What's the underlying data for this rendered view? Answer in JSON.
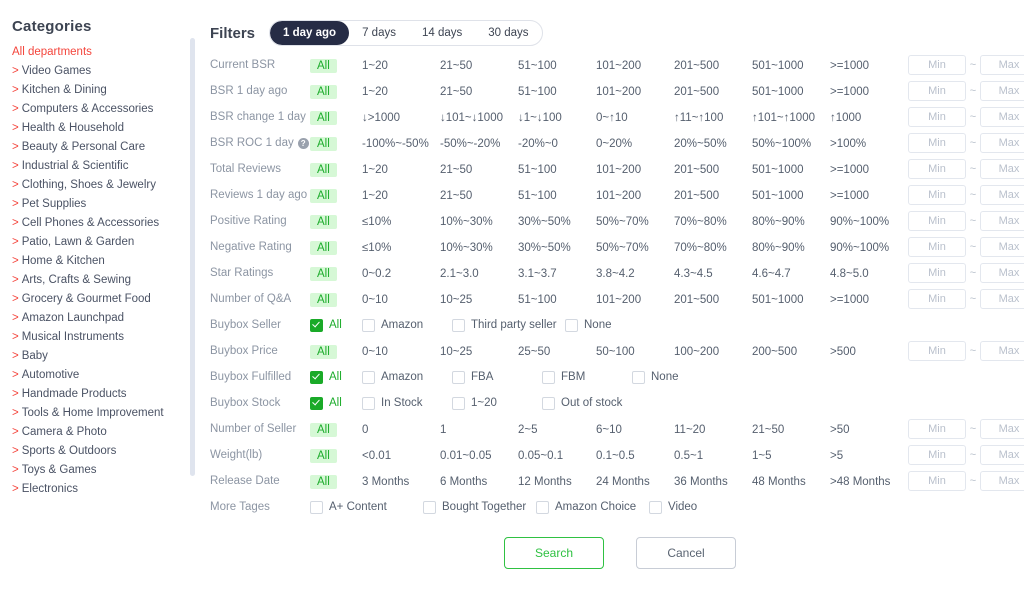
{
  "sidebar": {
    "title": "Categories",
    "active": "All departments",
    "items": [
      "Video Games",
      "Kitchen & Dining",
      "Computers & Accessories",
      "Health & Household",
      "Beauty & Personal Care",
      "Industrial & Scientific",
      "Clothing, Shoes & Jewelry",
      "Pet Supplies",
      "Cell Phones & Accessories",
      "Patio, Lawn & Garden",
      "Home & Kitchen",
      "Arts, Crafts & Sewing",
      "Grocery & Gourmet Food",
      "Amazon Launchpad",
      "Musical Instruments",
      "Baby",
      "Automotive",
      "Handmade Products",
      "Tools & Home Improvement",
      "Camera & Photo",
      "Sports & Outdoors",
      "Toys & Games",
      "Electronics"
    ]
  },
  "header": {
    "title": "Filters",
    "close_icon": "close-icon",
    "range_tabs": [
      {
        "label": "1 day ago",
        "active": true
      },
      {
        "label": "7 days",
        "active": false
      },
      {
        "label": "14 days",
        "active": false
      },
      {
        "label": "30 days",
        "active": false
      }
    ]
  },
  "minmax": {
    "min_placeholder": "Min",
    "max_placeholder": "Max",
    "dash": "~",
    "percent": "%"
  },
  "rows": [
    {
      "label": "Current BSR",
      "type": "chips",
      "help": false,
      "all": "All",
      "options": [
        "1~20",
        "21~50",
        "51~100",
        "101~200",
        "201~500",
        "501~1000",
        ">=1000"
      ],
      "minmax": true,
      "unit": ""
    },
    {
      "label": "BSR 1 day ago",
      "type": "chips",
      "help": false,
      "all": "All",
      "options": [
        "1~20",
        "21~50",
        "51~100",
        "101~200",
        "201~500",
        "501~1000",
        ">=1000"
      ],
      "minmax": true,
      "unit": ""
    },
    {
      "label": "BSR change 1 day",
      "type": "chips",
      "help": false,
      "all": "All",
      "options": [
        "↓>1000",
        "↓101~↓1000",
        "↓1~↓100",
        "0~↑10",
        "↑11~↑100",
        "↑101~↑1000",
        "↑1000"
      ],
      "minmax": true,
      "unit": ""
    },
    {
      "label": "BSR ROC 1 day",
      "type": "chips",
      "help": true,
      "all": "All",
      "options": [
        "-100%~-50%",
        "-50%~-20%",
        "-20%~0",
        "0~20%",
        "20%~50%",
        "50%~100%",
        ">100%"
      ],
      "minmax": true,
      "unit": "%"
    },
    {
      "label": "Total Reviews",
      "type": "chips",
      "help": false,
      "all": "All",
      "options": [
        "1~20",
        "21~50",
        "51~100",
        "101~200",
        "201~500",
        "501~1000",
        ">=1000"
      ],
      "minmax": true,
      "unit": ""
    },
    {
      "label": "Reviews 1 day ago",
      "type": "chips",
      "help": false,
      "all": "All",
      "options": [
        "1~20",
        "21~50",
        "51~100",
        "101~200",
        "201~500",
        "501~1000",
        ">=1000"
      ],
      "minmax": true,
      "unit": ""
    },
    {
      "label": "Positive Rating",
      "type": "chips",
      "help": false,
      "all": "All",
      "options": [
        "≤10%",
        "10%~30%",
        "30%~50%",
        "50%~70%",
        "70%~80%",
        "80%~90%",
        "90%~100%"
      ],
      "minmax": true,
      "unit": "%"
    },
    {
      "label": "Negative Rating",
      "type": "chips",
      "help": false,
      "all": "All",
      "options": [
        "≤10%",
        "10%~30%",
        "30%~50%",
        "50%~70%",
        "70%~80%",
        "80%~90%",
        "90%~100%"
      ],
      "minmax": true,
      "unit": "%"
    },
    {
      "label": "Star Ratings",
      "type": "chips",
      "help": false,
      "all": "All",
      "options": [
        "0~0.2",
        "2.1~3.0",
        "3.1~3.7",
        "3.8~4.2",
        "4.3~4.5",
        "4.6~4.7",
        "4.8~5.0"
      ],
      "minmax": true,
      "unit": ""
    },
    {
      "label": "Number of Q&A",
      "type": "chips",
      "help": false,
      "all": "All",
      "options": [
        "0~10",
        "10~25",
        "51~100",
        "101~200",
        "201~500",
        "501~1000",
        ">=1000"
      ],
      "minmax": true,
      "unit": ""
    },
    {
      "label": "Buybox Seller",
      "type": "checks",
      "help": false,
      "checks": [
        {
          "label": "All",
          "checked": true
        },
        {
          "label": "Amazon",
          "checked": false
        },
        {
          "label": "Third party seller",
          "checked": false
        },
        {
          "label": "None",
          "checked": false
        }
      ],
      "minmax": false,
      "unit": ""
    },
    {
      "label": "Buybox Price",
      "type": "chips",
      "help": false,
      "all": "All",
      "options": [
        "0~10",
        "10~25",
        "25~50",
        "50~100",
        "100~200",
        "200~500",
        ">500"
      ],
      "minmax": true,
      "unit": ""
    },
    {
      "label": "Buybox Fulfilled",
      "type": "checks",
      "help": false,
      "checks": [
        {
          "label": "All",
          "checked": true
        },
        {
          "label": "Amazon",
          "checked": false
        },
        {
          "label": "FBA",
          "checked": false
        },
        {
          "label": "FBM",
          "checked": false
        },
        {
          "label": "None",
          "checked": false
        }
      ],
      "minmax": false,
      "unit": ""
    },
    {
      "label": "Buybox Stock",
      "type": "checks",
      "help": false,
      "checks": [
        {
          "label": "All",
          "checked": true
        },
        {
          "label": "In Stock",
          "checked": false
        },
        {
          "label": "1~20",
          "checked": false
        },
        {
          "label": "Out of stock",
          "checked": false
        }
      ],
      "minmax": false,
      "unit": ""
    },
    {
      "label": "Number of Seller",
      "type": "chips",
      "help": false,
      "all": "All",
      "options": [
        "0",
        "1",
        "2~5",
        "6~10",
        "11~20",
        "21~50",
        ">50"
      ],
      "minmax": true,
      "unit": ""
    },
    {
      "label": "Weight(lb)",
      "type": "chips",
      "help": false,
      "all": "All",
      "options": [
        "<0.01",
        "0.01~0.05",
        "0.05~0.1",
        "0.1~0.5",
        "0.5~1",
        "1~5",
        ">5"
      ],
      "minmax": true,
      "unit": ""
    },
    {
      "label": "Release Date",
      "type": "chips",
      "help": false,
      "all": "All",
      "options": [
        "3 Months",
        "6 Months",
        "12 Months",
        "24 Months",
        "36 Months",
        "48 Months",
        ">48 Months"
      ],
      "minmax": true,
      "unit": ""
    },
    {
      "label": "More Tages",
      "type": "checks",
      "help": false,
      "checks": [
        {
          "label": "A+ Content",
          "checked": false
        },
        {
          "label": "Bought Together",
          "checked": false
        },
        {
          "label": "Amazon Choice",
          "checked": false
        },
        {
          "label": "Video",
          "checked": false
        }
      ],
      "minmax": false,
      "unit": ""
    }
  ],
  "footer": {
    "search_label": "Search",
    "cancel_label": "Cancel"
  },
  "colors": {
    "accent_green": "#2fc142",
    "chip_green_bg": "#d6f8d6",
    "chip_green_text": "#1dac2c",
    "active_tab_bg": "#262c45",
    "category_active": "#f4453c"
  }
}
